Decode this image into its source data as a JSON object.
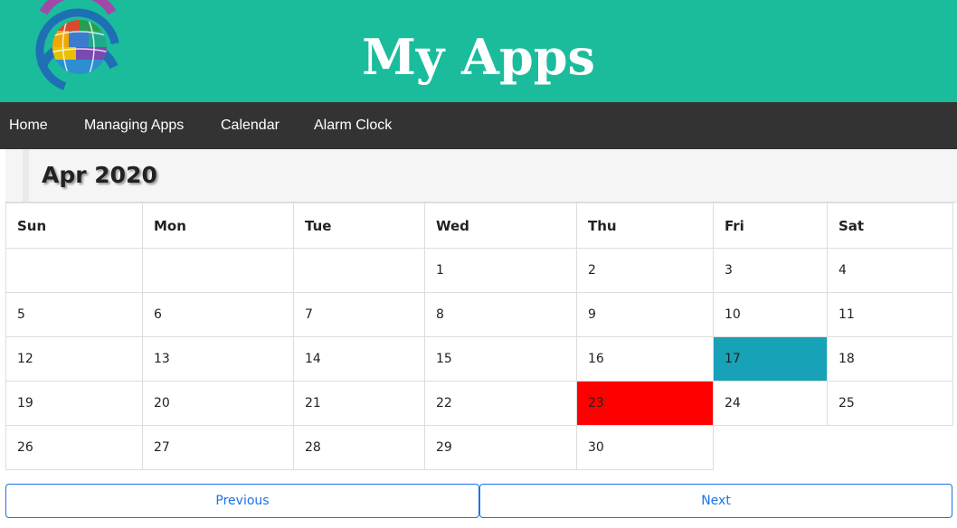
{
  "header": {
    "title": "My Apps",
    "logo_icon": "globe-logo-icon"
  },
  "nav": {
    "items": [
      {
        "label": "Home"
      },
      {
        "label": "Managing Apps"
      },
      {
        "label": "Calendar"
      },
      {
        "label": "Alarm Clock"
      }
    ]
  },
  "calendar": {
    "month_label": "Apr 2020",
    "weekdays": [
      "Sun",
      "Mon",
      "Tue",
      "Wed",
      "Thu",
      "Fri",
      "Sat"
    ],
    "weeks": [
      [
        "",
        "",
        "",
        "1",
        "2",
        "3",
        "4"
      ],
      [
        "5",
        "6",
        "7",
        "8",
        "9",
        "10",
        "11"
      ],
      [
        "12",
        "13",
        "14",
        "15",
        "16",
        "17",
        "18"
      ],
      [
        "19",
        "20",
        "21",
        "22",
        "23",
        "24",
        "25"
      ],
      [
        "26",
        "27",
        "28",
        "29",
        "30"
      ]
    ],
    "today_day": "17",
    "highlighted_day": "23"
  },
  "pager": {
    "previous_label": "Previous",
    "next_label": "Next"
  },
  "colors": {
    "header_bg": "#1abc9c",
    "nav_bg": "#333333",
    "today": "#17a2b8",
    "highlight": "#ff0000",
    "button_accent": "#1a73e8"
  }
}
